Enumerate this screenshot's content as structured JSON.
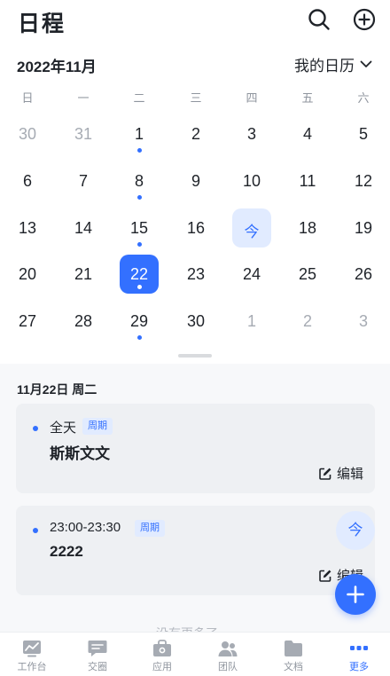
{
  "header": {
    "title": "日程",
    "search_icon": "search-icon",
    "add_icon": "plus-circle-icon"
  },
  "calendar": {
    "month_title": "2022年11月",
    "calendar_select": "我的日历",
    "weekdays": [
      "日",
      "一",
      "二",
      "三",
      "四",
      "五",
      "六"
    ],
    "weeks": [
      [
        {
          "n": "30",
          "m": true
        },
        {
          "n": "31",
          "m": true
        },
        {
          "n": "1",
          "dot": true
        },
        {
          "n": "2"
        },
        {
          "n": "3"
        },
        {
          "n": "4"
        },
        {
          "n": "5"
        }
      ],
      [
        {
          "n": "6"
        },
        {
          "n": "7"
        },
        {
          "n": "8",
          "dot": true
        },
        {
          "n": "9"
        },
        {
          "n": "10"
        },
        {
          "n": "11"
        },
        {
          "n": "12"
        }
      ],
      [
        {
          "n": "13"
        },
        {
          "n": "14"
        },
        {
          "n": "15",
          "dot": true
        },
        {
          "n": "16"
        },
        {
          "n": "今",
          "today": true
        },
        {
          "n": "18"
        },
        {
          "n": "19"
        }
      ],
      [
        {
          "n": "20"
        },
        {
          "n": "21"
        },
        {
          "n": "22",
          "dot": true,
          "selected": true
        },
        {
          "n": "23"
        },
        {
          "n": "24"
        },
        {
          "n": "25"
        },
        {
          "n": "26"
        }
      ],
      [
        {
          "n": "27"
        },
        {
          "n": "28"
        },
        {
          "n": "29",
          "dot": true
        },
        {
          "n": "30"
        },
        {
          "n": "1",
          "m": true
        },
        {
          "n": "2",
          "m": true
        },
        {
          "n": "3",
          "m": true
        }
      ]
    ]
  },
  "day_list": {
    "date_header": "11月22日 周二",
    "events": [
      {
        "time": "全天",
        "tag": "周期",
        "title": "斯斯文文",
        "edit_label": "编辑"
      },
      {
        "time": "23:00-23:30",
        "tag": "周期",
        "title": "2222",
        "edit_label": "编辑"
      }
    ],
    "more_text": "没有更多了"
  },
  "fab": {
    "today_label": "今",
    "add_icon": "plus-icon"
  },
  "tabbar": {
    "items": [
      {
        "label": "工作台",
        "icon": "chart-icon"
      },
      {
        "label": "交圈",
        "icon": "chat-icon"
      },
      {
        "label": "应用",
        "icon": "app-box-icon"
      },
      {
        "label": "团队",
        "icon": "team-icon"
      },
      {
        "label": "文档",
        "icon": "folder-icon"
      },
      {
        "label": "更多",
        "icon": "more-dots-icon",
        "active": true
      }
    ]
  },
  "colors": {
    "accent": "#3370ff",
    "accent_light": "#e1ebff",
    "text": "#1f2329",
    "muted": "#a6abb3"
  }
}
